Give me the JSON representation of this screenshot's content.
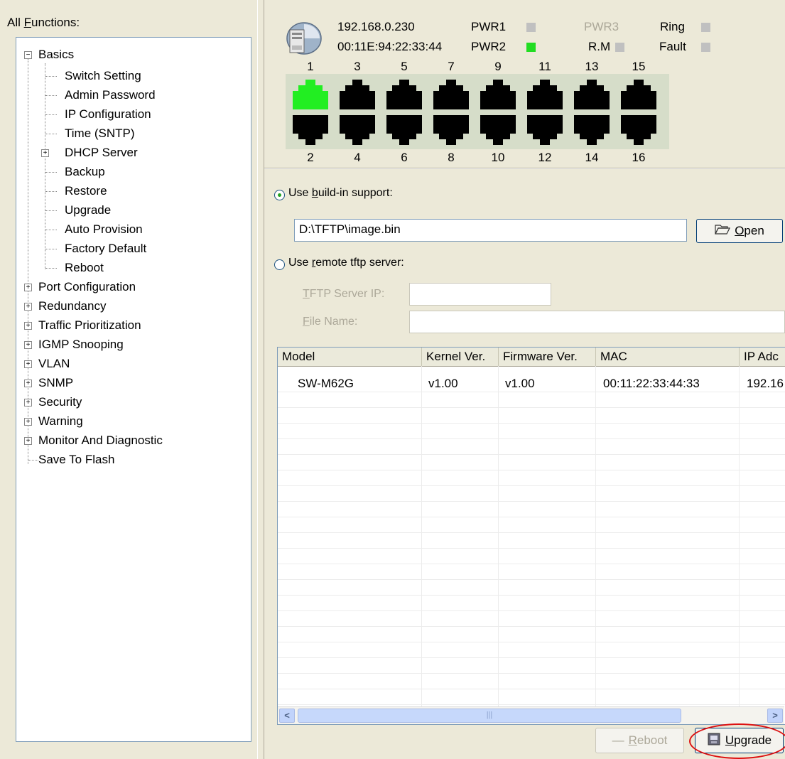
{
  "left": {
    "title_prefix": "All ",
    "title_mnemonic": "F",
    "title_rest": "unctions:",
    "tree": {
      "basics": "Basics",
      "basics_children": [
        "Switch Setting",
        "Admin Password",
        "IP Configuration",
        "Time (SNTP)",
        "DHCP Server",
        "Backup",
        "Restore",
        "Upgrade",
        "Auto Provision",
        "Factory Default",
        "Reboot"
      ],
      "groups": [
        "Port Configuration",
        "Redundancy",
        "Traffic Prioritization",
        "IGMP Snooping",
        "VLAN",
        "SNMP",
        "Security",
        "Warning",
        "Monitor And Diagnostic"
      ],
      "last": "Save To Flash"
    }
  },
  "device": {
    "ip": "192.168.0.230",
    "mac": "00:11E:94:22:33:44",
    "pwr1_label": "PWR1",
    "pwr2_label": "PWR2",
    "pwr3_label": "PWR3",
    "rm_label": "R.M",
    "ring_label": "Ring",
    "fault_label": "Fault",
    "pwr1_on": false,
    "pwr2_on": true,
    "pwr3_on": false,
    "rm_on": false,
    "ring_on": false,
    "fault_on": false,
    "active_port_color": "#22ee22",
    "idle_port_color": "#000000",
    "ports_top": [
      "1",
      "3",
      "5",
      "7",
      "9",
      "11",
      "13",
      "15"
    ],
    "ports_bottom": [
      "2",
      "4",
      "6",
      "8",
      "10",
      "12",
      "14",
      "16"
    ],
    "active_ports": [
      "1"
    ]
  },
  "form": {
    "builtin_pre": "Use ",
    "builtin_mn": "b",
    "builtin_post": "uild-in support:",
    "file_path": "D:\\TFTP\\image.bin",
    "open_mn": "O",
    "open_post": "pen",
    "remote_pre": "Use ",
    "remote_mn": "r",
    "remote_post": "emote tftp server:",
    "tftp_ip_mn": "T",
    "tftp_ip_post": "FTP Server IP:",
    "file_name_mn": "F",
    "file_name_post": "ile Name:",
    "tftp_ip_value": "",
    "file_name_value": ""
  },
  "table": {
    "columns": [
      "Model",
      "Kernel Ver.",
      "Firmware Ver.",
      "MAC",
      "IP Adc"
    ],
    "rows": [
      [
        "SW-M62G",
        "v1.00",
        "v1.00",
        "00:11:22:33:44:33",
        "192.16"
      ]
    ]
  },
  "buttons": {
    "reboot_mn": "R",
    "reboot_post": "eboot",
    "upgrade_mn": "U",
    "upgrade_post": "pgrade"
  }
}
